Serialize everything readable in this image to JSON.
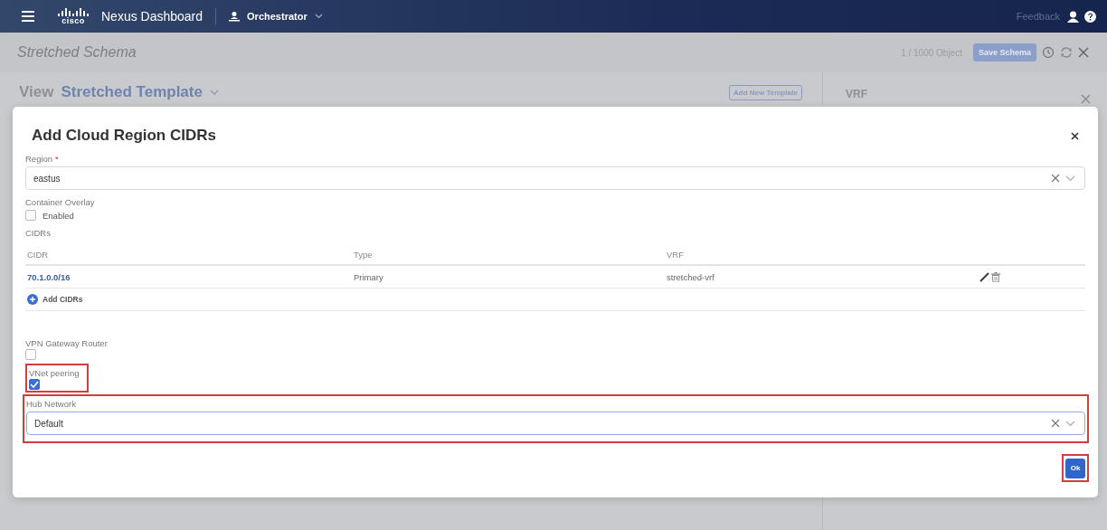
{
  "header": {
    "logo_text": "cisco",
    "product": "Nexus Dashboard",
    "app": "Orchestrator",
    "feedback": "Feedback"
  },
  "schema_bar": {
    "title": "Stretched Schema",
    "object_count": "1 / 1000 Object",
    "save_button": "Save Schema"
  },
  "view": {
    "label": "View",
    "template": "Stretched Template",
    "add_template_button": "Add New Template"
  },
  "side_panel": {
    "title": "VRF"
  },
  "dialog": {
    "title": "Add Cloud Region CIDRs",
    "region": {
      "label": "Region",
      "required_mark": "*",
      "value": "eastus"
    },
    "container_overlay": {
      "label": "Container Overlay",
      "option": "Enabled",
      "checked": false
    },
    "cidrs": {
      "label": "CIDRs",
      "columns": [
        "CIDR",
        "Type",
        "VRF"
      ],
      "rows": [
        {
          "cidr": "70.1.0.0/16",
          "type": "Primary",
          "vrf": "stretched-vrf"
        }
      ],
      "add_button": "Add CIDRs"
    },
    "vpn_gateway": {
      "label": "VPN Gateway Router",
      "checked": false
    },
    "vnet_peering": {
      "label": "VNet peering",
      "checked": true,
      "highlighted": true
    },
    "hub_network": {
      "label": "Hub Network",
      "value": "Default",
      "highlighted": true
    },
    "ok_button": {
      "label": "Ok",
      "highlighted": true
    }
  }
}
